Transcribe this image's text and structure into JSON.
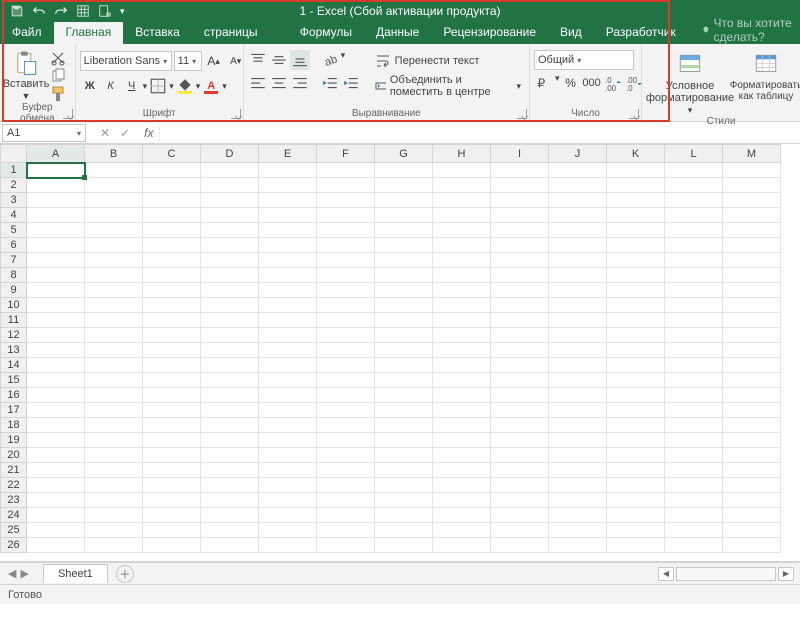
{
  "title": "1 - Excel (Сбой активации продукта)",
  "tabs": {
    "file": "Файл",
    "home": "Главная",
    "insert": "Вставка",
    "layout": "Разметка страницы",
    "formulas": "Формулы",
    "data": "Данные",
    "review": "Рецензирование",
    "view": "Вид",
    "developer": "Разработчик"
  },
  "tell_me": "Что вы хотите сделать?",
  "ribbon": {
    "clipboard": {
      "paste": "Вставить",
      "label": "Буфер обмена"
    },
    "font": {
      "name": "Liberation Sans",
      "size": "11",
      "bold": "Ж",
      "italic": "К",
      "underline": "Ч",
      "label": "Шрифт"
    },
    "align": {
      "wrap": "Перенести текст",
      "merge": "Объединить и поместить в центре",
      "label": "Выравнивание"
    },
    "number": {
      "format": "Общий",
      "label": "Число"
    },
    "styles": {
      "cond": "Условное форматирование",
      "table": "Форматировать как таблицу",
      "label": "Стили"
    }
  },
  "namebox": "A1",
  "columns": [
    "A",
    "B",
    "C",
    "D",
    "E",
    "F",
    "G",
    "H",
    "I",
    "J",
    "K",
    "L",
    "M"
  ],
  "rows": [
    "1",
    "2",
    "3",
    "4",
    "5",
    "6",
    "7",
    "8",
    "9",
    "10",
    "11",
    "12",
    "13",
    "14",
    "15",
    "16",
    "17",
    "18",
    "19",
    "20",
    "21",
    "22",
    "23",
    "24",
    "25",
    "26"
  ],
  "sheet": "Sheet1",
  "status": "Готово"
}
